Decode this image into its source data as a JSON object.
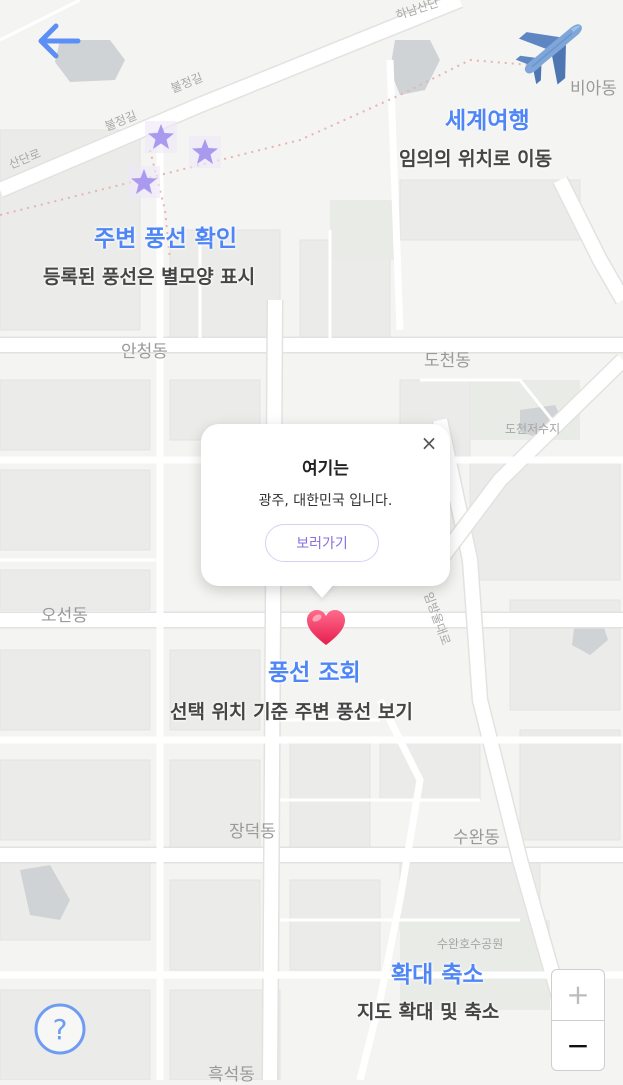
{
  "map": {
    "labels": {
      "anchung": "안청동",
      "docheon": "도천동",
      "docheon_reservoir": "도천저수지",
      "oseon": "오선동",
      "jangdeok": "장덕동",
      "suwan": "수완동",
      "suwanhosu_park": "수완호수공원",
      "heukseok": "흑석동",
      "bulgeong_1": "불정길",
      "bulgeong_2": "불정길",
      "biadong": "비아동",
      "sanupdaero": "산단로",
      "imbang": "임방울대로",
      "hanam": "하남산단"
    },
    "colors": {
      "background": "#f4f4f2",
      "road": "#ffffff",
      "water": "#cfd3d6"
    }
  },
  "header": {
    "back_icon": "arrow-left-icon",
    "world_travel_icon": "airplane-icon"
  },
  "tips": {
    "world_travel": {
      "title": "세계여행",
      "desc": "임의의 위치로 이동"
    },
    "nearby_balloons": {
      "title": "주변 풍선 확인",
      "desc": "등록된 풍선은 별모양 표시"
    },
    "balloon_lookup": {
      "title": "풍선 조회",
      "desc": "선택 위치 기준 주변 풍선 보기"
    },
    "zoom": {
      "title": "확대 축소",
      "desc": "지도 확대 및 축소"
    }
  },
  "popup": {
    "title": "여기는",
    "text": "광주, 대한민국 입니다.",
    "button": "보러가기",
    "close": "×"
  },
  "zoom": {
    "in": "+",
    "out": "−"
  },
  "help": {
    "icon": "question-circle-icon",
    "label": "?"
  },
  "colors": {
    "accent": "#4f86f7",
    "star": "#a99af0",
    "heart": "#f0416a",
    "popup_button_text": "#8a6fe0"
  }
}
